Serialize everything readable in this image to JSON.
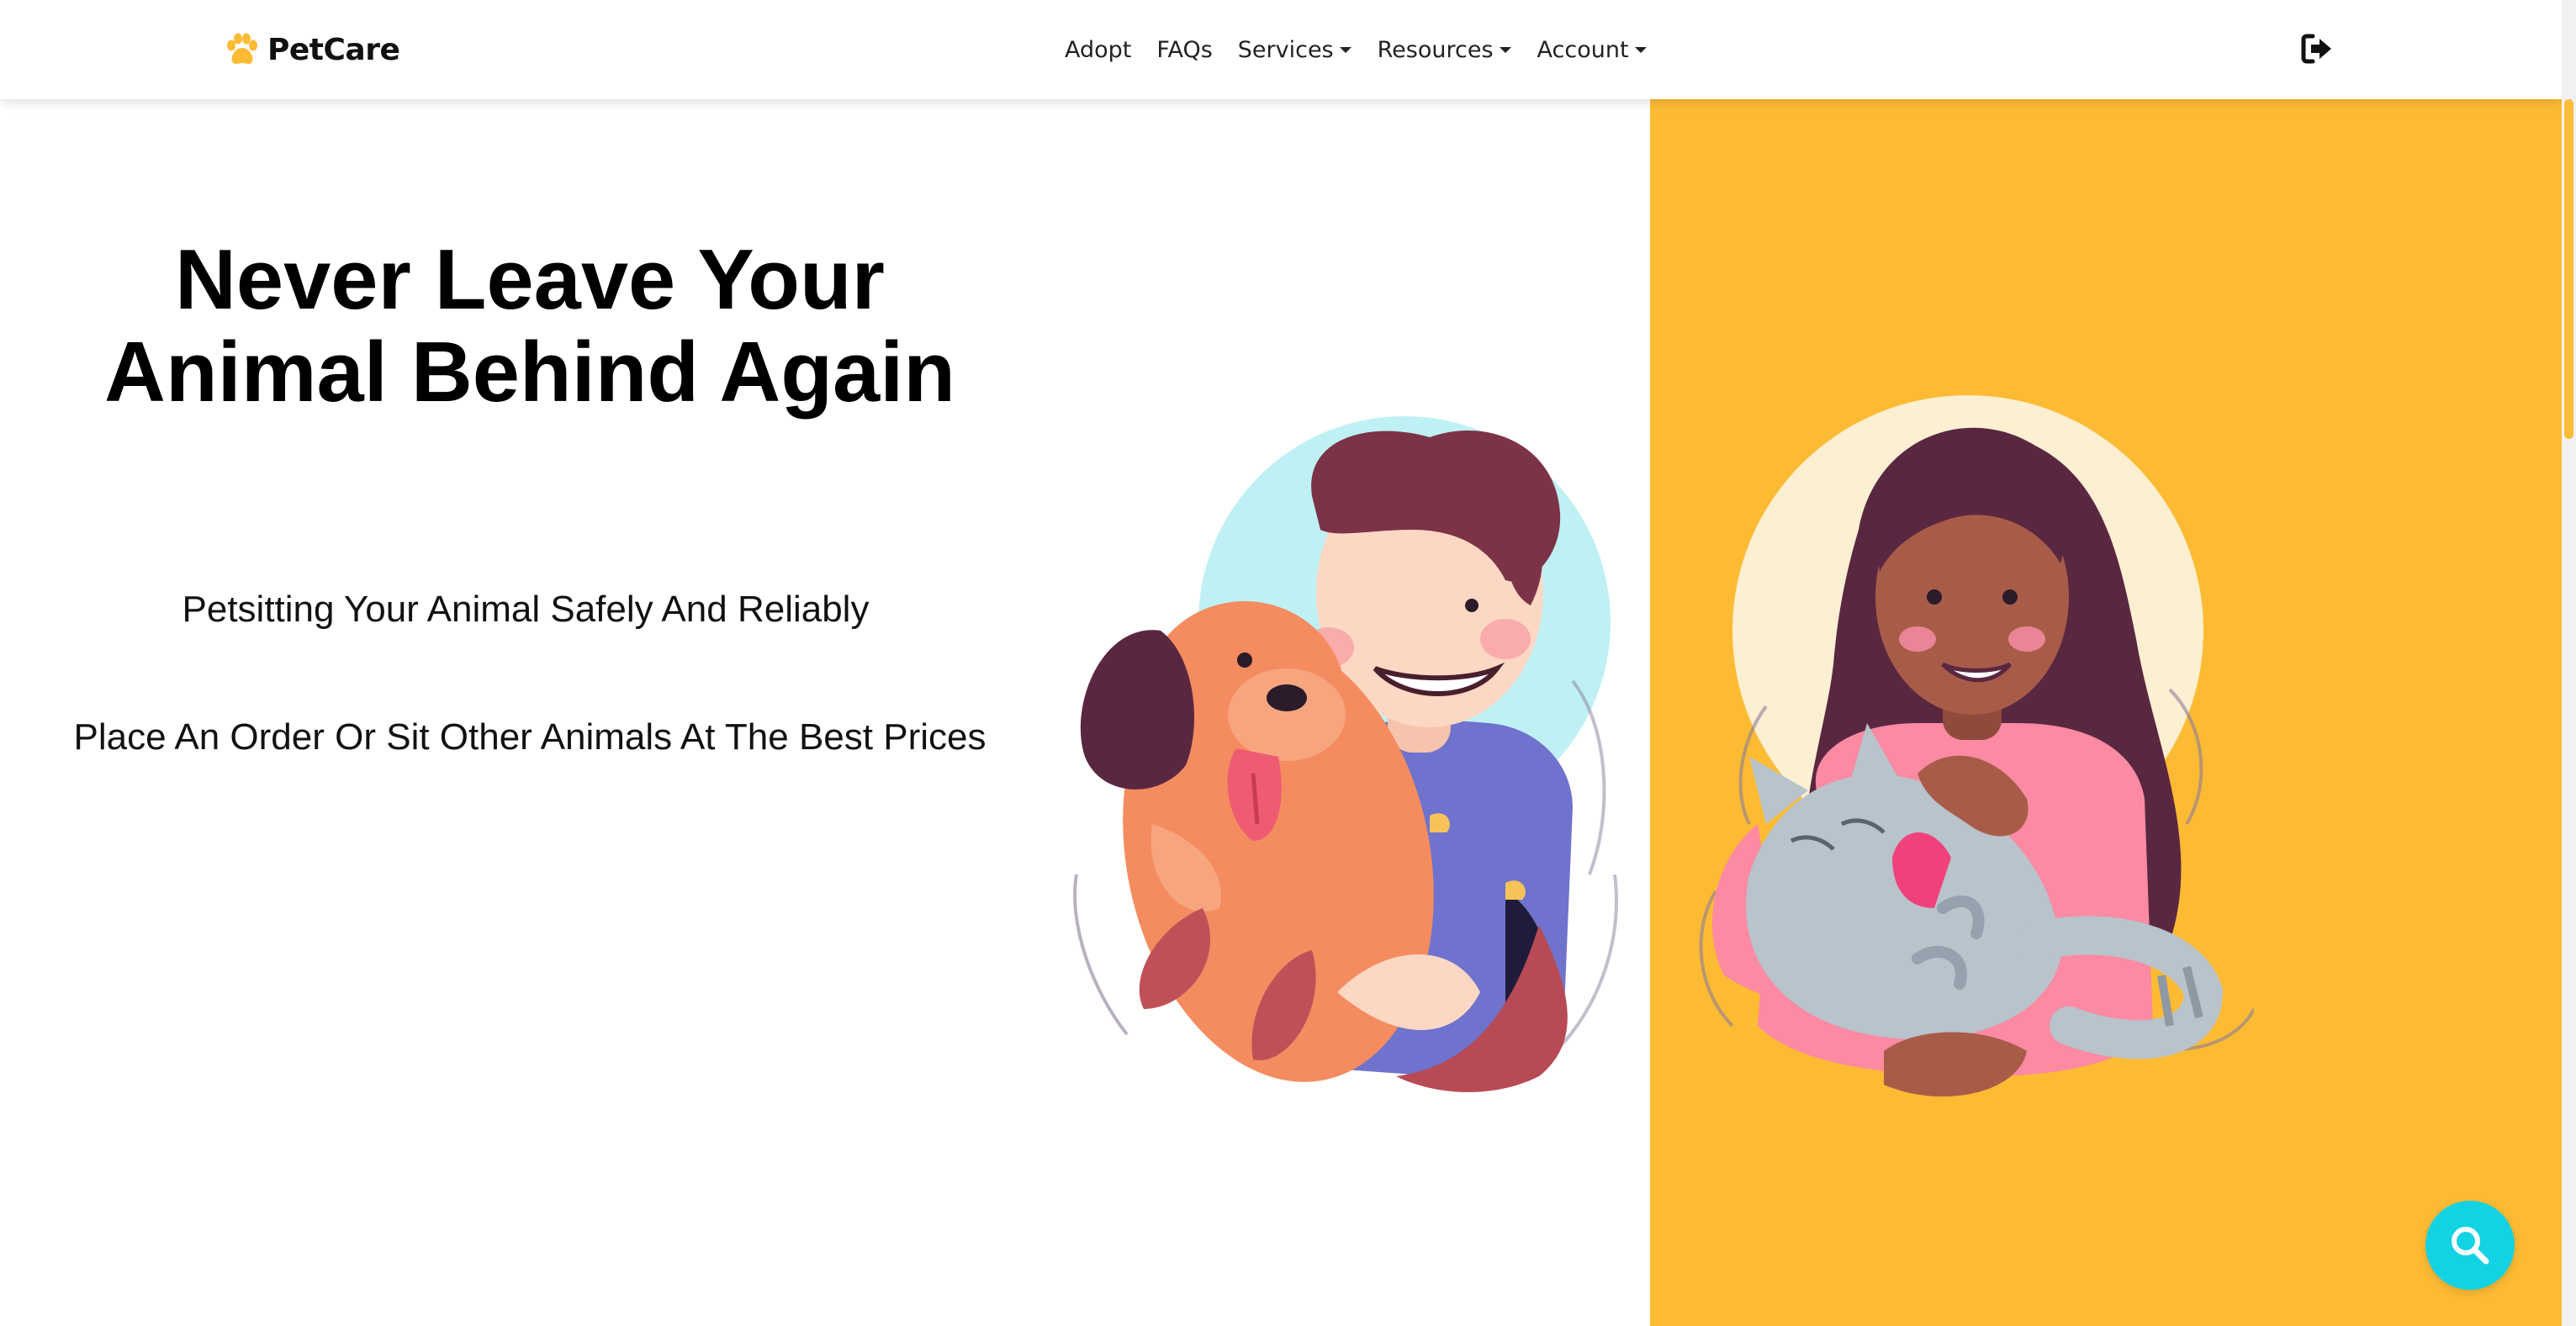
{
  "brand": {
    "name": "PetCare",
    "icon": "paw-icon",
    "accent": "#fdbb34"
  },
  "nav": {
    "links": [
      {
        "label": "Adopt",
        "dropdown": false
      },
      {
        "label": "FAQs",
        "dropdown": false
      },
      {
        "label": "Services",
        "dropdown": true
      },
      {
        "label": "Resources",
        "dropdown": true
      },
      {
        "label": "Account",
        "dropdown": true
      }
    ],
    "logout_icon": "sign-out-icon"
  },
  "hero": {
    "title_line1": "Never Leave Your",
    "title_line2": "Animal Behind Again",
    "tagline1": "Petsitting Your Animal Safely And Reliably",
    "tagline2": "Place An Order Or Sit Other Animals At The Best Prices",
    "panel_color": "#fdbb34"
  },
  "illustrations": {
    "left": "man-hugging-dog-illustration",
    "right": "woman-holding-cat-illustration"
  },
  "search_button": {
    "icon": "search-icon",
    "color": "#13d2e4"
  }
}
